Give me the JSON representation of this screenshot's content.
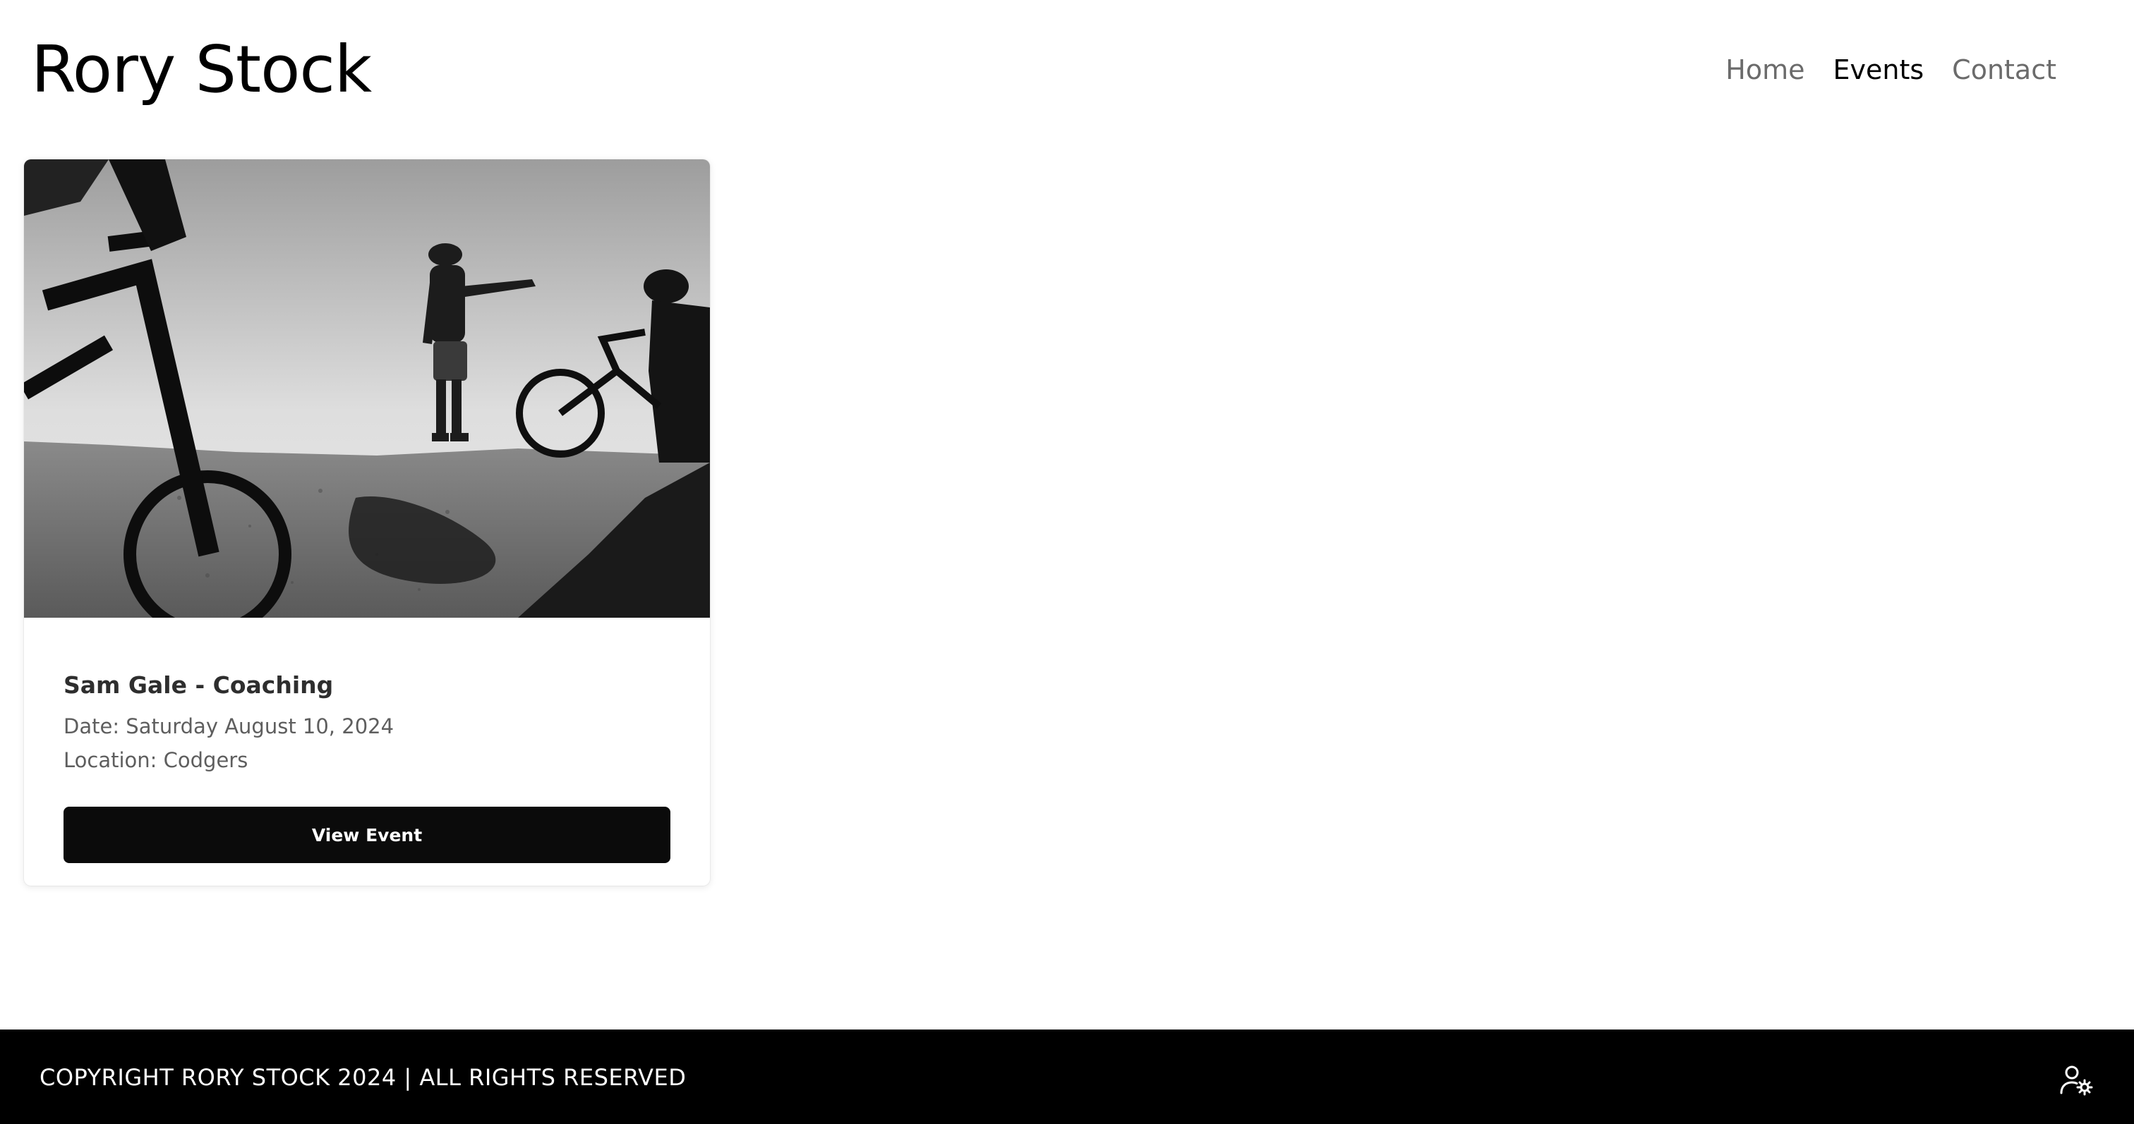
{
  "site": {
    "title": "Rory Stock"
  },
  "nav": {
    "items": [
      {
        "label": "Home",
        "active": false
      },
      {
        "label": "Events",
        "active": true
      },
      {
        "label": "Contact",
        "active": false
      }
    ]
  },
  "events": [
    {
      "title": "Sam Gale - Coaching",
      "date": "Date: Saturday August 10, 2024",
      "location": "Location: Codgers",
      "button_label": "View Event",
      "image_icon": "mountain-bike-coaching-photo"
    }
  ],
  "footer": {
    "copyright": "COPYRIGHT RORY STOCK 2024 | ALL RIGHTS RESERVED",
    "admin_icon": "user-settings-icon"
  },
  "colors": {
    "text_primary": "#000000",
    "nav_inactive": "#6b6b6b",
    "button_bg": "#0b0b0b",
    "footer_bg": "#000000"
  }
}
